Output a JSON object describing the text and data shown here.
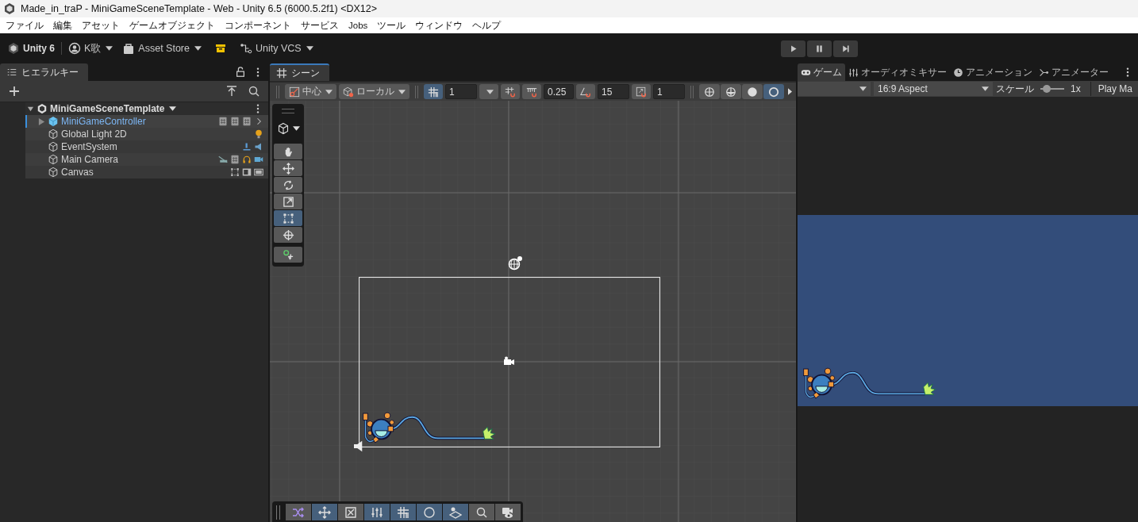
{
  "window": {
    "title": "Made_in_traP - MiniGameSceneTemplate - Web - Unity 6.5 (6000.5.2f1) <DX12>"
  },
  "menu": [
    "ファイル",
    "編集",
    "アセット",
    "ゲームオブジェクト",
    "コンポーネント",
    "サービス",
    "Jobs",
    "ツール",
    "ウィンドウ",
    "ヘルプ"
  ],
  "toolbar": {
    "product": "Unity 6",
    "account": "K歌",
    "asset_store": "Asset Store",
    "vcs": "Unity VCS"
  },
  "play_controls": [
    {
      "kind": "play",
      "selected": false
    },
    {
      "kind": "pause",
      "selected": false
    },
    {
      "kind": "step",
      "selected": false
    }
  ],
  "hierarchy": {
    "tab": "ヒエラルキー",
    "scene": {
      "name": "MiniGameSceneTemplate",
      "expanded": true,
      "children": [
        {
          "name": "MiniGameController",
          "selected": true,
          "expanded": false,
          "kind": "prefab",
          "icons": [
            {
              "kind": "script"
            },
            {
              "kind": "script"
            },
            {
              "kind": "script"
            },
            {
              "kind": "chevron"
            }
          ]
        },
        {
          "name": "Global Light 2D",
          "selected": false,
          "kind": "object",
          "icons": [
            {
              "kind": "light"
            }
          ]
        },
        {
          "name": "EventSystem",
          "selected": false,
          "kind": "object",
          "icons": [
            {
              "kind": "event"
            },
            {
              "kind": "input"
            }
          ]
        },
        {
          "name": "Main Camera",
          "selected": false,
          "kind": "object",
          "icons": [
            {
              "kind": "camera-off"
            },
            {
              "kind": "script"
            },
            {
              "kind": "audio"
            },
            {
              "kind": "camera"
            }
          ]
        },
        {
          "name": "Canvas",
          "selected": false,
          "kind": "object",
          "icons": [
            {
              "kind": "rect"
            },
            {
              "kind": "panel"
            },
            {
              "kind": "canvas"
            }
          ]
        }
      ]
    }
  },
  "scene": {
    "tab": "シーン",
    "toolbar": {
      "pivot": "中心",
      "space": "ローカル",
      "grid": {
        "selected": true
      },
      "grid_size": "1",
      "move_snap": "0.25",
      "rotate_snap": "15",
      "scale_snap": "1",
      "shading": [
        {
          "kind": "wire",
          "selected": false
        },
        {
          "kind": "shaded-wire",
          "selected": false
        },
        {
          "kind": "shaded",
          "selected": false
        },
        {
          "kind": "unlit",
          "selected": true
        }
      ]
    },
    "tools": [
      {
        "kind": "hand",
        "selected": false
      },
      {
        "kind": "move",
        "selected": false
      },
      {
        "kind": "rotate",
        "selected": false
      },
      {
        "kind": "scale",
        "selected": false
      },
      {
        "kind": "rect",
        "selected": true
      },
      {
        "kind": "transform",
        "selected": false
      },
      {
        "kind": "custom",
        "selected": false
      }
    ],
    "overlay": [
      {
        "kind": "shuffle",
        "selected": false
      },
      {
        "kind": "move",
        "selected": true
      },
      {
        "kind": "fx",
        "selected": false
      },
      {
        "kind": "sliders",
        "selected": true
      },
      {
        "kind": "grid",
        "selected": true
      },
      {
        "kind": "moon",
        "selected": true
      },
      {
        "kind": "layers",
        "selected": true
      },
      {
        "kind": "search",
        "selected": false
      },
      {
        "kind": "camera-eye",
        "selected": false
      }
    ]
  },
  "game": {
    "tabs": [
      {
        "label": "ゲーム",
        "kind": "gamepad",
        "selected": true
      },
      {
        "label": "オーディオミキサー",
        "kind": "sliders",
        "selected": false
      },
      {
        "label": "アニメーション",
        "kind": "clock",
        "selected": false
      },
      {
        "label": "アニメーター",
        "kind": "animator",
        "selected": false
      }
    ],
    "toolbar": {
      "aspect": "16:9 Aspect",
      "scale_label": "スケール",
      "scale": {
        "level": 0.15
      },
      "scale_value": "1x",
      "play_mode": "Play Ma"
    }
  }
}
